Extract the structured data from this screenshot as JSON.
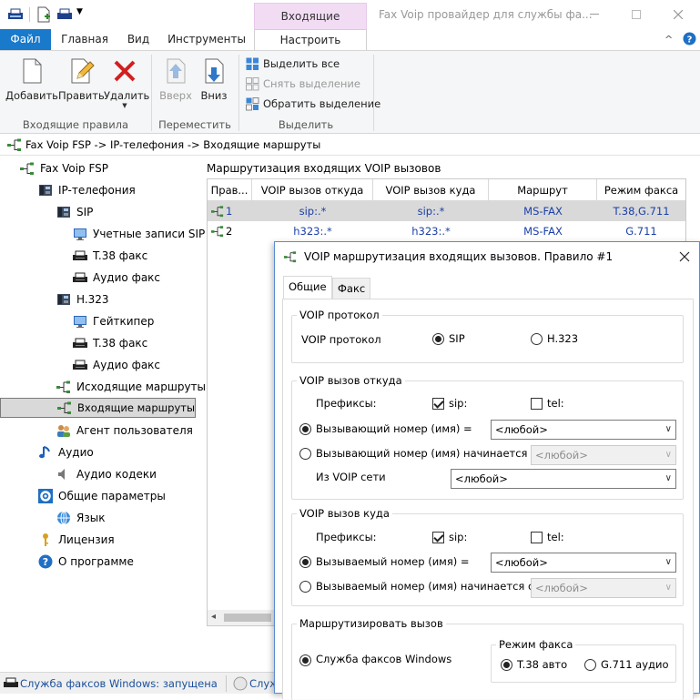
{
  "window": {
    "context_tab": "Входящие маршруты",
    "title": "Fax Voip провайдер для службы фа..."
  },
  "ribbon": {
    "tabs": [
      "Файл",
      "Главная",
      "Вид",
      "Инструменты",
      "Настроить"
    ],
    "buttons": {
      "add": "Добавить",
      "edit": "Править",
      "delete": "Удалить",
      "up": "Вверх",
      "down": "Вниз"
    },
    "selection": {
      "select_all": "Выделить все",
      "deselect": "Снять выделение",
      "invert": "Обратить выделение"
    },
    "groups": [
      "Входящие правила",
      "Переместить",
      "Выделить"
    ]
  },
  "breadcrumb": "Fax Voip FSP -> IP-телефония -> Входящие маршруты",
  "tree": [
    {
      "label": "Fax Voip FSP",
      "icon": "route-icon"
    },
    {
      "label": "IP-телефония",
      "icon": "phone-icon"
    },
    {
      "label": "SIP",
      "icon": "phone-icon"
    },
    {
      "label": "Учетные записи SIP",
      "icon": "monitor-icon"
    },
    {
      "label": "T.38 факс",
      "icon": "fax-icon"
    },
    {
      "label": "Аудио факс",
      "icon": "fax-icon"
    },
    {
      "label": "H.323",
      "icon": "phone-icon"
    },
    {
      "label": "Гейткипер",
      "icon": "monitor-icon"
    },
    {
      "label": "T.38 факс",
      "icon": "fax-icon"
    },
    {
      "label": "Аудио факс",
      "icon": "fax-icon"
    },
    {
      "label": "Исходящие маршруты",
      "icon": "route-icon"
    },
    {
      "label": "Входящие маршруты",
      "icon": "route-icon"
    },
    {
      "label": "Агент пользователя",
      "icon": "users-icon"
    },
    {
      "label": "Аудио",
      "icon": "note-icon"
    },
    {
      "label": "Аудио кодеки",
      "icon": "speaker-icon"
    },
    {
      "label": "Общие параметры",
      "icon": "gear-icon"
    },
    {
      "label": "Язык",
      "icon": "globe-icon"
    },
    {
      "label": "Лицензия",
      "icon": "key-icon"
    },
    {
      "label": "О программе",
      "icon": "help-icon"
    }
  ],
  "routes": {
    "group_label": "Маршрутизация входящих VOIP вызовов",
    "columns": [
      "Прав...",
      "VOIP вызов откуда",
      "VOIP вызов куда",
      "Маршрут",
      "Режим факса"
    ],
    "rows": [
      [
        "1",
        "sip:.*",
        "sip:.*",
        "MS-FAX",
        "T.38,G.711"
      ],
      [
        "2",
        "h323:.*",
        "h323:.*",
        "MS-FAX",
        "G.711"
      ]
    ]
  },
  "status": {
    "service": "Служба факсов Windows: запущена",
    "second": "Служ"
  },
  "dialog": {
    "title": "VOIP маршрутизация входящих вызовов. Правило #1",
    "tabs": [
      "Общие",
      "Факс"
    ],
    "protocol": {
      "legend": "VOIP протокол",
      "label": "VOIP протокол",
      "options": [
        "SIP",
        "H.323"
      ],
      "selected": "SIP"
    },
    "from": {
      "legend": "VOIP вызов откуда",
      "prefixes_label": "Префиксы:",
      "prefix_sip": "sip:",
      "prefix_tel": "tel:",
      "caller_eq": "Вызывающий номер (имя) =",
      "caller_eq_value": "<любой>",
      "caller_starts": "Вызывающий номер (имя) начинается с",
      "caller_starts_value": "<любой>",
      "network_label": "Из VOIP сети",
      "network_value": "<любой>"
    },
    "to": {
      "legend": "VOIP вызов куда",
      "prefixes_label": "Префиксы:",
      "prefix_sip": "sip:",
      "prefix_tel": "tel:",
      "callee_eq": "Вызываемый номер (имя) =",
      "callee_eq_value": "<любой>",
      "callee_starts": "Вызываемый номер (имя) начинается с",
      "callee_starts_value": "<любой>"
    },
    "route": {
      "legend": "Маршрутизировать вызов",
      "service": "Служба факсов Windows",
      "fax_mode_legend": "Режим факса",
      "fax_modes": [
        "T.38 авто",
        "G.711 аудио"
      ],
      "fax_mode_selected": "T.38 авто"
    }
  }
}
